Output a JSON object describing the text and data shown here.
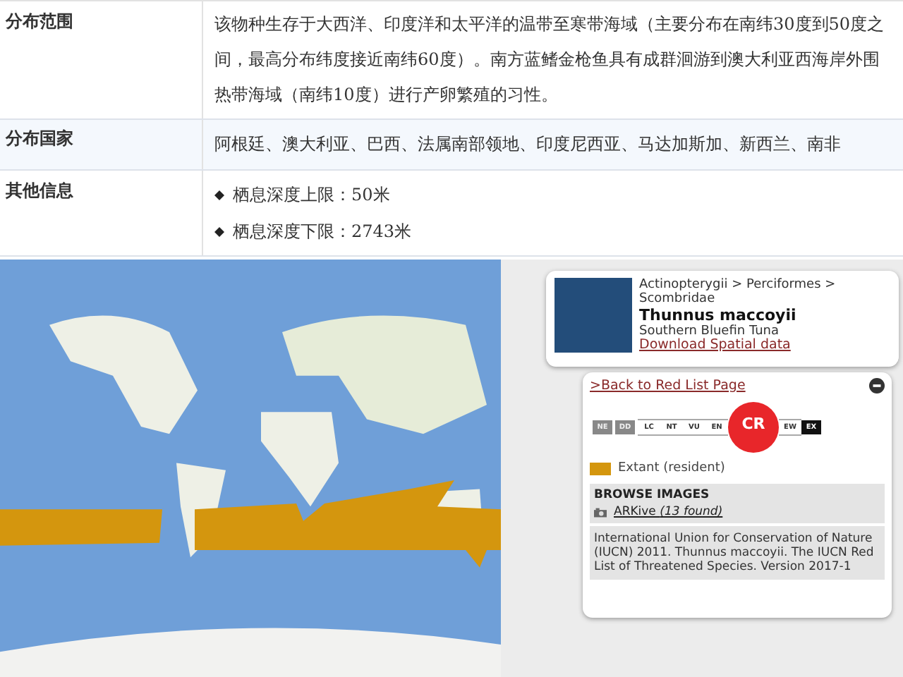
{
  "info_table": {
    "rows": [
      {
        "label": "分布范围",
        "text": "该物种生存于大西洋、印度洋和太平洋的温带至寒带海域（主要分布在南纬30度到50度之间，最高分布纬度接近南纬60度）。南方蓝鳍金枪鱼具有成群洄游到澳大利亚西海岸外围热带海域（南纬10度）进行产卵繁殖的习性。",
        "shaded": false
      },
      {
        "label": "分布国家",
        "text": "阿根廷、澳大利亚、巴西、法属南部领地、印度尼西亚、马达加斯加、新西兰、南非",
        "shaded": true
      },
      {
        "label": "其他信息",
        "bullets": [
          "栖息深度上限：50米",
          "栖息深度下限：2743米"
        ],
        "shaded": false
      }
    ]
  },
  "species_card": {
    "taxonomy": "Actinopterygii > Perciformes > Scombridae",
    "scientific_name": "Thunnus maccoyii",
    "common_name": "Southern Bluefin Tuna",
    "link": "Download Spatial data"
  },
  "redlist_panel": {
    "back_link": ">Back to Red List Page",
    "status_scale": [
      {
        "code": "NE",
        "kind": "unassessed",
        "selected": false
      },
      {
        "code": "DD",
        "kind": "unassessed",
        "selected": false
      },
      {
        "code": "LC",
        "kind": "assessed",
        "selected": false
      },
      {
        "code": "NT",
        "kind": "assessed",
        "selected": false
      },
      {
        "code": "VU",
        "kind": "assessed",
        "selected": false
      },
      {
        "code": "EN",
        "kind": "assessed",
        "selected": false
      },
      {
        "code": "CR",
        "kind": "assessed",
        "selected": true
      },
      {
        "code": "EW",
        "kind": "assessed",
        "selected": false
      },
      {
        "code": "EX",
        "kind": "extinct",
        "selected": false
      }
    ],
    "legend_label": "Extant (resident)",
    "browse_images": {
      "heading": "BROWSE IMAGES",
      "link": "ARKive",
      "count": "(13 found)"
    },
    "citation": "International Union for Conservation of Nature (IUCN) 2011. Thunnus maccoyii. The IUCN Red List of Threatened Species. Version 2017-1"
  }
}
